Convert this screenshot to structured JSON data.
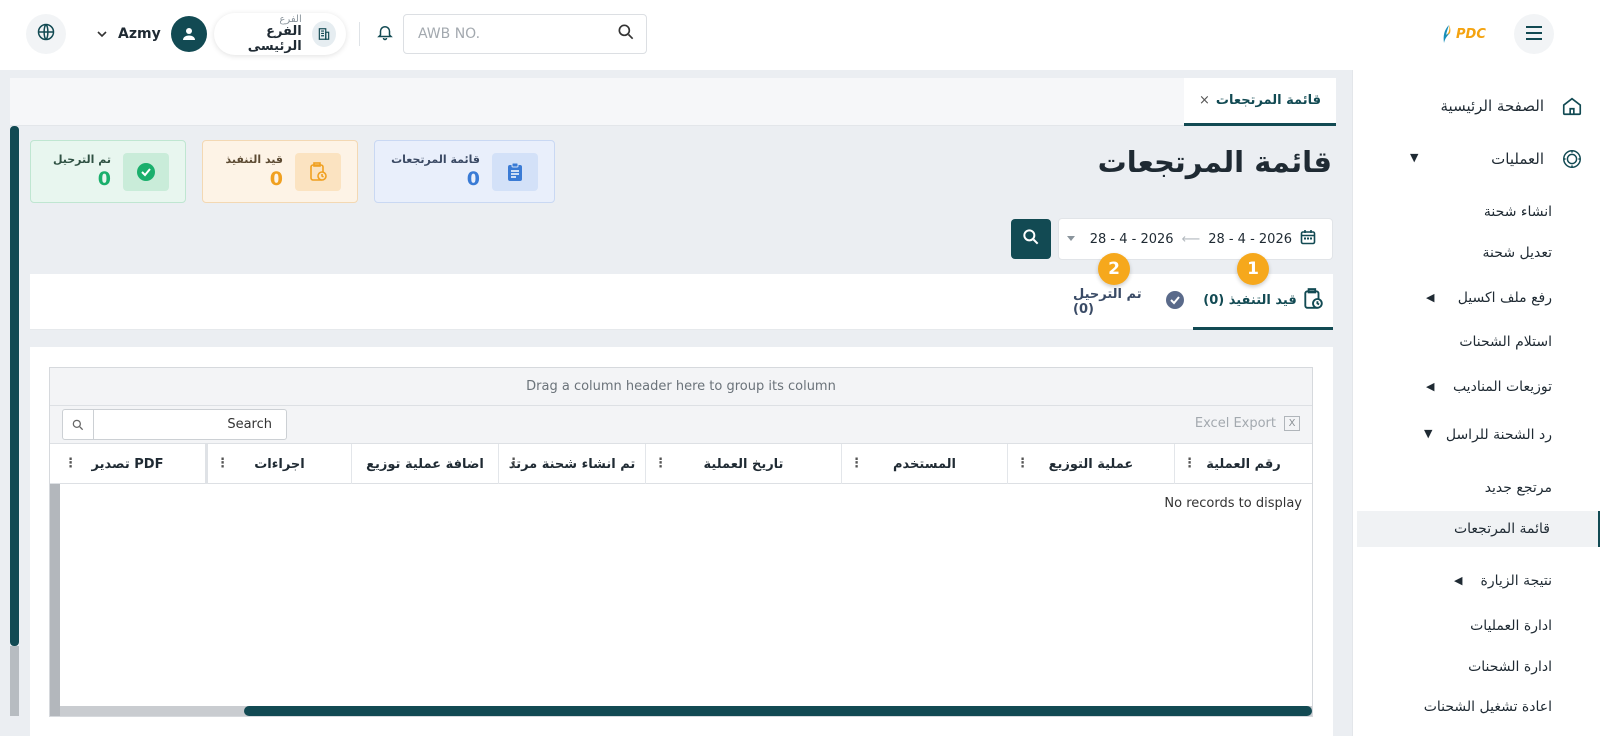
{
  "header": {
    "user_name": "Azmy",
    "branch_label": "الفرع",
    "branch_value": "الفرع الرئيسى",
    "awb_placeholder": "AWB NO.",
    "logo_text": "PDC"
  },
  "sidebar": {
    "home": "الصفحة الرئيسية",
    "operations": "العمليات",
    "items": [
      "انشاء شحنة",
      "تعديل شحنة",
      "رفع ملف اكسيل",
      "استلام الشحنات",
      "توزيعات المناديب",
      "رد الشحنة للراسل",
      "مرتجع جديد",
      "قائمة المرتجعات",
      "نتيجة الزيارة",
      "ادارة العمليات",
      "ادارة الشحنات",
      "اعادة تشغيل الشحنات"
    ]
  },
  "open_tab": {
    "label": "قائمة المرتجعات",
    "close": "×"
  },
  "page_title": "قائمة المرتجعات",
  "cards": {
    "returns": {
      "label": "قائمة المرتجعات",
      "value": "0"
    },
    "in_progress": {
      "label": "قيد التنفيذ",
      "value": "0"
    },
    "dispatched": {
      "label": "تم الترحيل",
      "value": "0"
    }
  },
  "date_range": {
    "from": "28 - 4 - 2026",
    "to": "28 - 4 - 2026",
    "arrow": "⟵"
  },
  "status_tabs": {
    "in_progress": "قيد التنفيذ (0)",
    "dispatched": "تم الترحيل (0)",
    "badge_1": "1",
    "badge_2": "2"
  },
  "grid": {
    "group_hint": "Drag a column header here to group its column",
    "excel_export": "Excel Export",
    "excel_icon": "X",
    "search_placeholder": "Search",
    "columns": [
      "رقم العملية",
      "عملية التوزيع",
      "المستخدم",
      "تاريخ العملية",
      "تم انشاء شحنة مرتد",
      "اضافة عملية توزيع",
      "اجراءات",
      "تصدير PDF"
    ],
    "empty_text": "No records to display"
  },
  "colors": {
    "primary": "#124a53",
    "accent_orange": "#f6a81c",
    "card_blue": "#3a7bd5",
    "card_orange": "#f0a020",
    "card_green": "#1aaf6c"
  }
}
